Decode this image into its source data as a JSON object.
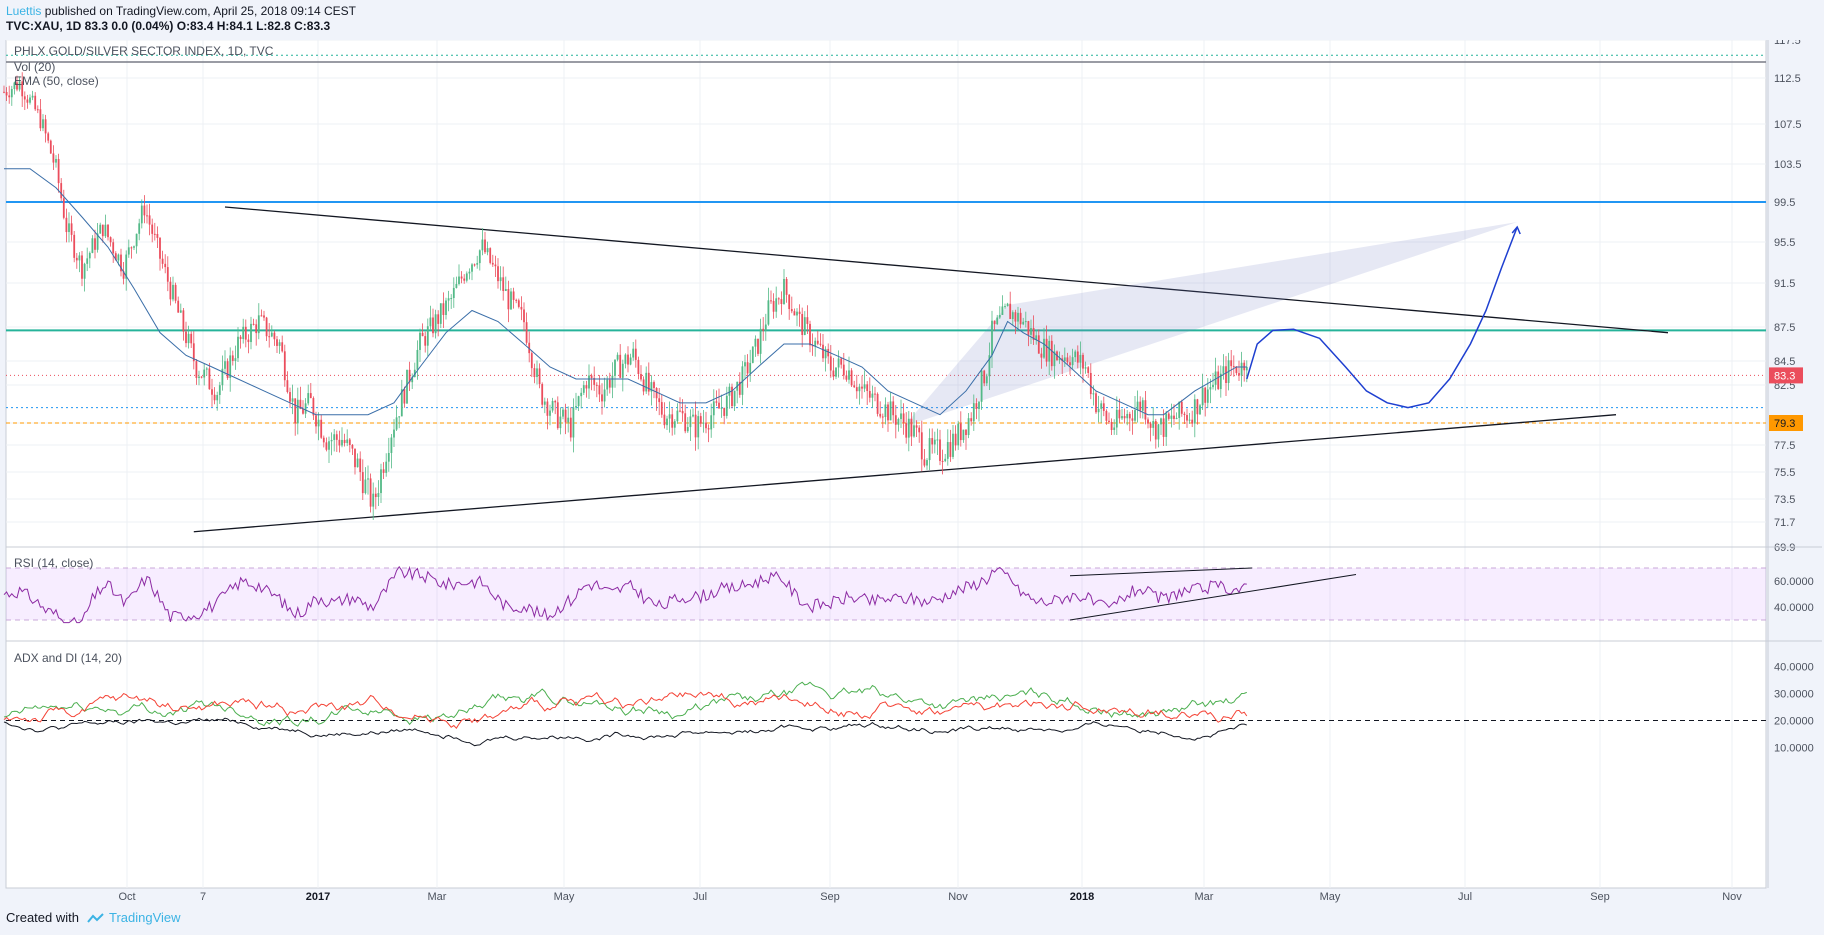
{
  "header": {
    "user": "Luettis",
    "published": " published on TradingView.com, April 25, 2018 09:14 CEST",
    "quote": "TVC:XAU, 1D  83.3  0.0 (0.04%)  O:83.4  H:84.1  L:82.8  C:83.3"
  },
  "footer": {
    "created_with": "Created with",
    "brand": "TradingView"
  },
  "colors": {
    "up": "#53b987",
    "down": "#eb4d5c",
    "ema": "#3a6ea8",
    "rsi": "#8c2aa3",
    "adx": "#131722",
    "di_plus": "#4caf50",
    "di_minus": "#f44336",
    "resistance": "#2196f3",
    "teal": "#26b39a"
  },
  "chart_data": [
    {
      "type": "candlestick",
      "pane": "price",
      "title": "PHLX GOLD/SILVER SECTOR INDEX, 1D, TVC",
      "indicators": [
        "Vol (20)",
        "EMA (50, close)"
      ],
      "y_ticks": [
        "117.5",
        "112.5",
        "107.5",
        "103.5",
        "99.5",
        "95.5",
        "91.5",
        "87.5",
        "84.5",
        "82.5",
        "79.3",
        "77.5",
        "75.5",
        "73.5",
        "71.7",
        "69.9"
      ],
      "x_ticks": [
        "Oct",
        "7",
        "2017",
        "Mar",
        "May",
        "Jul",
        "Sep",
        "Nov",
        "2018",
        "Mar",
        "May",
        "Jul",
        "Sep",
        "Nov"
      ],
      "x_tick_bold": [
        "2017",
        "2018"
      ],
      "last_price": "83.3",
      "marked_level": "79.3",
      "close_path": [
        [
          0,
          111
        ],
        [
          6,
          112
        ],
        [
          14,
          108
        ],
        [
          20,
          103
        ],
        [
          24,
          97
        ],
        [
          30,
          93
        ],
        [
          38,
          97
        ],
        [
          46,
          93
        ],
        [
          54,
          99
        ],
        [
          60,
          94
        ],
        [
          68,
          88
        ],
        [
          74,
          84
        ],
        [
          82,
          82
        ],
        [
          90,
          86
        ],
        [
          98,
          88
        ],
        [
          106,
          86
        ],
        [
          112,
          80
        ],
        [
          118,
          81
        ],
        [
          124,
          78
        ],
        [
          130,
          78
        ],
        [
          136,
          76
        ],
        [
          142,
          73
        ],
        [
          148,
          78
        ],
        [
          154,
          82
        ],
        [
          160,
          86
        ],
        [
          166,
          88
        ],
        [
          172,
          90
        ],
        [
          178,
          93
        ],
        [
          184,
          95
        ],
        [
          188,
          93
        ],
        [
          194,
          90
        ],
        [
          200,
          88
        ],
        [
          206,
          82
        ],
        [
          212,
          80
        ],
        [
          218,
          79
        ],
        [
          224,
          83
        ],
        [
          230,
          82
        ],
        [
          236,
          84
        ],
        [
          242,
          85
        ],
        [
          248,
          82
        ],
        [
          254,
          80
        ],
        [
          260,
          80
        ],
        [
          266,
          79
        ],
        [
          272,
          80
        ],
        [
          278,
          81
        ],
        [
          284,
          83
        ],
        [
          290,
          86
        ],
        [
          294,
          89
        ],
        [
          300,
          91
        ],
        [
          306,
          88
        ],
        [
          312,
          86
        ],
        [
          318,
          84
        ],
        [
          324,
          84
        ],
        [
          330,
          82
        ],
        [
          336,
          81
        ],
        [
          342,
          80
        ],
        [
          348,
          79
        ],
        [
          352,
          78
        ],
        [
          354,
          77
        ],
        [
          360,
          77
        ],
        [
          366,
          78
        ],
        [
          372,
          80
        ],
        [
          378,
          84
        ],
        [
          380,
          87
        ],
        [
          386,
          89
        ],
        [
          392,
          88
        ],
        [
          398,
          86
        ],
        [
          404,
          85
        ],
        [
          410,
          85
        ],
        [
          416,
          84
        ],
        [
          420,
          81
        ],
        [
          426,
          79
        ],
        [
          432,
          80
        ],
        [
          438,
          81
        ],
        [
          442,
          79
        ],
        [
          446,
          79
        ],
        [
          452,
          80
        ],
        [
          456,
          80
        ],
        [
          462,
          82
        ],
        [
          468,
          83
        ],
        [
          472,
          84
        ],
        [
          476,
          84
        ],
        [
          478,
          85
        ]
      ],
      "ema_path": [
        [
          0,
          103
        ],
        [
          10,
          103
        ],
        [
          20,
          101
        ],
        [
          30,
          98
        ],
        [
          40,
          95
        ],
        [
          50,
          91
        ],
        [
          60,
          87
        ],
        [
          70,
          85
        ],
        [
          80,
          84
        ],
        [
          90,
          83
        ],
        [
          100,
          82
        ],
        [
          110,
          81
        ],
        [
          120,
          80
        ],
        [
          130,
          80
        ],
        [
          140,
          80
        ],
        [
          150,
          81
        ],
        [
          160,
          84
        ],
        [
          170,
          87
        ],
        [
          180,
          89
        ],
        [
          190,
          88
        ],
        [
          200,
          86
        ],
        [
          210,
          84
        ],
        [
          220,
          83
        ],
        [
          230,
          83
        ],
        [
          240,
          83
        ],
        [
          250,
          82
        ],
        [
          260,
          81
        ],
        [
          270,
          81
        ],
        [
          280,
          82
        ],
        [
          290,
          84
        ],
        [
          300,
          86
        ],
        [
          310,
          86
        ],
        [
          320,
          85
        ],
        [
          330,
          84
        ],
        [
          340,
          82
        ],
        [
          350,
          81
        ],
        [
          360,
          80
        ],
        [
          370,
          82
        ],
        [
          380,
          85
        ],
        [
          386,
          88
        ],
        [
          392,
          87
        ],
        [
          400,
          86
        ],
        [
          410,
          84
        ],
        [
          420,
          82
        ],
        [
          430,
          81
        ],
        [
          440,
          80
        ],
        [
          446,
          80
        ],
        [
          452,
          81
        ],
        [
          458,
          82
        ],
        [
          466,
          83
        ],
        [
          474,
          84
        ],
        [
          478,
          84
        ]
      ],
      "resistance_line": {
        "price": 99.5,
        "label": ""
      },
      "lines": [
        {
          "name": "upper-trendline",
          "from": [
            85,
            99
          ],
          "to": [
            640,
            87
          ]
        },
        {
          "name": "lower-trendline",
          "from": [
            73,
            71
          ],
          "to": [
            620,
            80
          ]
        },
        {
          "name": "horizontal-teal",
          "price": 87.2
        },
        {
          "name": "dotted-blue",
          "price": 80.6
        },
        {
          "name": "dotted-orange",
          "price": 79.3
        },
        {
          "name": "dotted-red",
          "price": 83.3
        },
        {
          "name": "dotted-top",
          "price": 115.5
        }
      ],
      "projection": [
        [
          478,
          83
        ],
        [
          482,
          86
        ],
        [
          488,
          87.2
        ],
        [
          496,
          87.3
        ],
        [
          506,
          86.5
        ],
        [
          516,
          84
        ],
        [
          524,
          82
        ],
        [
          532,
          81
        ],
        [
          540,
          80.6
        ],
        [
          548,
          81
        ],
        [
          556,
          83
        ],
        [
          564,
          86
        ],
        [
          570,
          89
        ],
        [
          576,
          93
        ],
        [
          582,
          97
        ]
      ]
    },
    {
      "type": "line",
      "pane": "rsi",
      "title": "RSI (14, close)",
      "y_ticks": [
        "60.0000",
        "40.0000"
      ],
      "band": [
        30,
        70
      ],
      "trend_channel": {
        "upper": [
          [
            410,
            64
          ],
          [
            480,
            70
          ]
        ],
        "lower": [
          [
            410,
            30
          ],
          [
            520,
            65
          ]
        ]
      }
    },
    {
      "type": "line",
      "pane": "adx",
      "title": "ADX and DI (14, 20)",
      "y_ticks": [
        "40.0000",
        "30.0000",
        "20.0000",
        "10.0000"
      ],
      "reference_level": 20,
      "series": [
        {
          "name": "ADX"
        },
        {
          "name": "+DI"
        },
        {
          "name": "-DI"
        }
      ]
    }
  ]
}
